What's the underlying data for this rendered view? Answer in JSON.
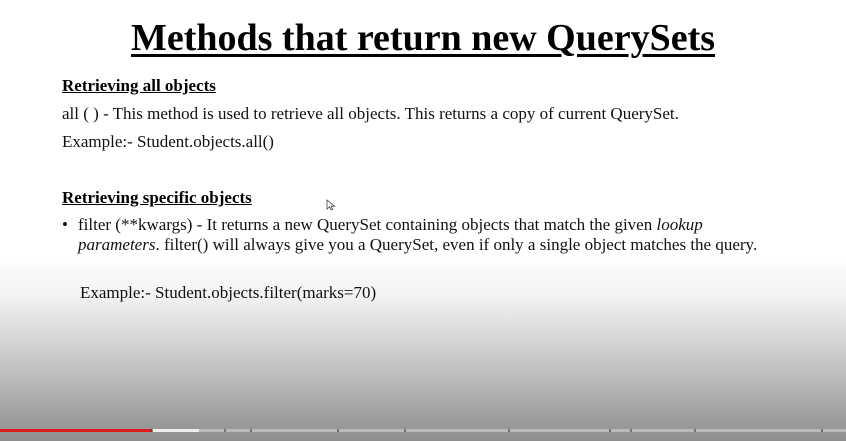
{
  "slide": {
    "title": "Methods that return new QuerySets",
    "section1": {
      "heading": "Retrieving all objects",
      "description": "all ( ) - This method is used to retrieve all objects. This returns a copy of current QuerySet.",
      "example": "Example:- Student.objects.all()"
    },
    "section2": {
      "heading": "Retrieving specific objects",
      "bullet": "•",
      "text_part1": "filter (**kwargs) - It returns a new QuerySet containing objects that match the given ",
      "text_italic": "lookup parameters",
      "text_part2": ". filter() will always give you a QuerySet, even if only a single object matches the query.",
      "example": "Example:- Student.objects.filter(marks=70)"
    }
  },
  "video_player": {
    "played_fraction": 0.18,
    "buffered_fraction": 0.235,
    "chapter_marks": [
      0.178,
      0.265,
      0.296,
      0.398,
      0.478,
      0.6,
      0.72,
      0.745,
      0.82,
      0.97
    ],
    "played_color": "#e01b1b"
  },
  "icons": {
    "cursor": "mouse-pointer-icon"
  }
}
